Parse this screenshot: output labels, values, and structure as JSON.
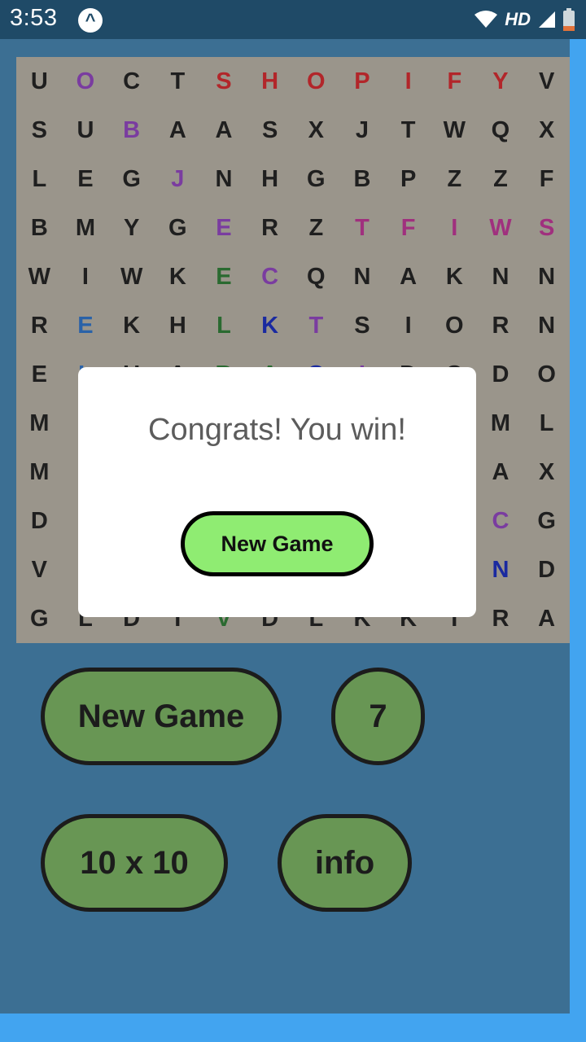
{
  "status_bar": {
    "time": "3:53",
    "network_label": "HD"
  },
  "grid": {
    "rows": [
      [
        "U",
        "O",
        "C",
        "T",
        "S",
        "H",
        "O",
        "P",
        "I",
        "F",
        "Y",
        "V"
      ],
      [
        "S",
        "U",
        "B",
        "A",
        "A",
        "S",
        "X",
        "J",
        "T",
        "W",
        "Q",
        "X"
      ],
      [
        "L",
        "E",
        "G",
        "J",
        "N",
        "H",
        "G",
        "B",
        "P",
        "Z",
        "Z",
        "F"
      ],
      [
        "B",
        "M",
        "Y",
        "G",
        "E",
        "R",
        "Z",
        "T",
        "F",
        "I",
        "W",
        "S"
      ],
      [
        "W",
        "I",
        "W",
        "K",
        "E",
        "C",
        "Q",
        "N",
        "A",
        "K",
        "N",
        "N"
      ],
      [
        "R",
        "E",
        "K",
        "H",
        "L",
        "K",
        "T",
        "S",
        "I",
        "O",
        "R",
        "N"
      ],
      [
        "E",
        "L",
        "U",
        "A",
        "B",
        "A",
        "O",
        "I",
        "D",
        "O",
        "D",
        "O"
      ],
      [
        "M",
        "",
        "",
        "",
        "",
        "",
        "",
        "",
        "",
        "",
        "M",
        "L"
      ],
      [
        "M",
        "",
        "",
        "",
        "",
        "",
        "",
        "",
        "",
        "",
        "A",
        "X"
      ],
      [
        "D",
        "",
        "",
        "",
        "",
        "",
        "",
        "",
        "",
        "",
        "C",
        "G"
      ],
      [
        "V",
        "",
        "",
        "",
        "",
        "",
        "",
        "",
        "",
        "",
        "N",
        "D"
      ],
      [
        "G",
        "L",
        "D",
        "I",
        "V",
        "D",
        "L",
        "K",
        "K",
        "I",
        "R",
        "A"
      ]
    ],
    "colors": [
      [
        "#1f1f1f",
        "#7a3ca0",
        "#1f1f1f",
        "#1f1f1f",
        "#b2262a",
        "#b2262a",
        "#b2262a",
        "#b2262a",
        "#b2262a",
        "#b2262a",
        "#b2262a",
        "#1f1f1f"
      ],
      [
        "#1f1f1f",
        "#1f1f1f",
        "#7a3ca0",
        "#1f1f1f",
        "#1f1f1f",
        "#1f1f1f",
        "#1f1f1f",
        "#1f1f1f",
        "#1f1f1f",
        "#1f1f1f",
        "#1f1f1f",
        "#1f1f1f"
      ],
      [
        "#1f1f1f",
        "#1f1f1f",
        "#1f1f1f",
        "#7a3ca0",
        "#1f1f1f",
        "#1f1f1f",
        "#1f1f1f",
        "#1f1f1f",
        "#1f1f1f",
        "#1f1f1f",
        "#1f1f1f",
        "#1f1f1f"
      ],
      [
        "#1f1f1f",
        "#1f1f1f",
        "#1f1f1f",
        "#1f1f1f",
        "#7a3ca0",
        "#1f1f1f",
        "#1f1f1f",
        "#a0307e",
        "#a0307e",
        "#a0307e",
        "#a0307e",
        "#a0307e"
      ],
      [
        "#1f1f1f",
        "#1f1f1f",
        "#1f1f1f",
        "#1f1f1f",
        "#2a6a30",
        "#7a3ca0",
        "#1f1f1f",
        "#1f1f1f",
        "#1f1f1f",
        "#1f1f1f",
        "#1f1f1f",
        "#1f1f1f"
      ],
      [
        "#1f1f1f",
        "#2a62a8",
        "#1f1f1f",
        "#1f1f1f",
        "#2a6a30",
        "#1a2aa0",
        "#7a3ca0",
        "#1f1f1f",
        "#1f1f1f",
        "#1f1f1f",
        "#1f1f1f",
        "#1f1f1f"
      ],
      [
        "#1f1f1f",
        "#2a62a8",
        "#1f1f1f",
        "#1f1f1f",
        "#2a6a30",
        "#2a6a30",
        "#1a2aa0",
        "#7a3ca0",
        "#1f1f1f",
        "#1f1f1f",
        "#1f1f1f",
        "#1f1f1f"
      ],
      [
        "#1f1f1f",
        "#1f1f1f",
        "#1f1f1f",
        "#1f1f1f",
        "#1f1f1f",
        "#1f1f1f",
        "#1f1f1f",
        "#1f1f1f",
        "#1f1f1f",
        "#1f1f1f",
        "#1f1f1f",
        "#1f1f1f"
      ],
      [
        "#1f1f1f",
        "#1f1f1f",
        "#1f1f1f",
        "#1f1f1f",
        "#1f1f1f",
        "#1f1f1f",
        "#1f1f1f",
        "#1f1f1f",
        "#1f1f1f",
        "#1f1f1f",
        "#1f1f1f",
        "#1f1f1f"
      ],
      [
        "#1f1f1f",
        "#1f1f1f",
        "#1f1f1f",
        "#1f1f1f",
        "#1f1f1f",
        "#1f1f1f",
        "#1f1f1f",
        "#1f1f1f",
        "#1f1f1f",
        "#1f1f1f",
        "#7a3ca0",
        "#1f1f1f"
      ],
      [
        "#1f1f1f",
        "#1f1f1f",
        "#1f1f1f",
        "#1f1f1f",
        "#1f1f1f",
        "#1f1f1f",
        "#1f1f1f",
        "#1f1f1f",
        "#1f1f1f",
        "#1f1f1f",
        "#1a2aa0",
        "#1f1f1f"
      ],
      [
        "#1f1f1f",
        "#1f1f1f",
        "#1f1f1f",
        "#1f1f1f",
        "#2a6a30",
        "#1f1f1f",
        "#1f1f1f",
        "#1f1f1f",
        "#1f1f1f",
        "#1f1f1f",
        "#1f1f1f",
        "#1f1f1f"
      ]
    ]
  },
  "controls": {
    "new_game_label": "New Game",
    "count_label": "7",
    "size_label": "10 x 10",
    "info_label": "info"
  },
  "modal": {
    "message": "Congrats! You win!",
    "button_label": "New Game"
  },
  "theme": {
    "status_bar": "#1f4a67",
    "app_bg": "#3c6f93",
    "grid_bg": "#9a958b",
    "button_bg": "#689654",
    "modal_button_bg": "#8fec72"
  }
}
